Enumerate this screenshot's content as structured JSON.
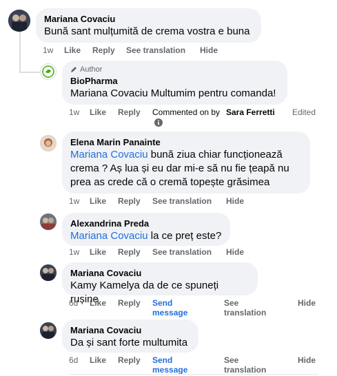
{
  "comments": [
    {
      "author": "Mariana Covaciu",
      "text": "Bună sant mulțumită de crema vostra e buna",
      "time": "1w",
      "like": "Like",
      "reply": "Reply",
      "translate": "See translation",
      "hide": "Hide"
    },
    {
      "author_tag": "Author",
      "author": "BioPharma",
      "text": "Mariana Covaciu Multumim pentru comanda!",
      "time": "1w",
      "like": "Like",
      "reply": "Reply",
      "commented_by_prefix": "Commented on by",
      "commented_by_name": "Sara Ferretti",
      "edited": "Edited"
    },
    {
      "author": "Elena Marin Panainte",
      "mention": "Mariana Covaciu",
      "text_line1": " bună ziua chiar funcționează",
      "text_line2": "crema ? Aș lua și eu dar mi-e să nu fie țeapă nu",
      "text_line3": "prea as crede că o cremă topește grăsimea",
      "time": "1w",
      "like": "Like",
      "reply": "Reply",
      "translate": "See translation",
      "hide": "Hide"
    },
    {
      "author": "Alexandrina Preda",
      "mention": "Mariana Covaciu",
      "text": " la ce preț este?",
      "time": "1w",
      "like": "Like",
      "reply": "Reply",
      "translate": "See translation",
      "hide": "Hide"
    },
    {
      "author": "Mariana Covaciu",
      "text": "Kamy Kamelya da de ce spuneți rușine",
      "time": "6d",
      "like": "Like",
      "reply": "Reply",
      "send1": "Send",
      "send2": "message",
      "see1": "See",
      "see2": "translation",
      "hide": "Hide"
    },
    {
      "author": "Mariana Covaciu",
      "text": "Da și sant forte multumita",
      "time": "6d",
      "like": "Like",
      "reply": "Reply",
      "send1": "Send",
      "send2": "message",
      "see1": "See",
      "see2": "translation",
      "hide": "Hide"
    }
  ],
  "colors": {
    "bubble": "#f0f2f5",
    "meta": "#65676b",
    "mention": "#216fdb",
    "link": "#216fdb"
  }
}
